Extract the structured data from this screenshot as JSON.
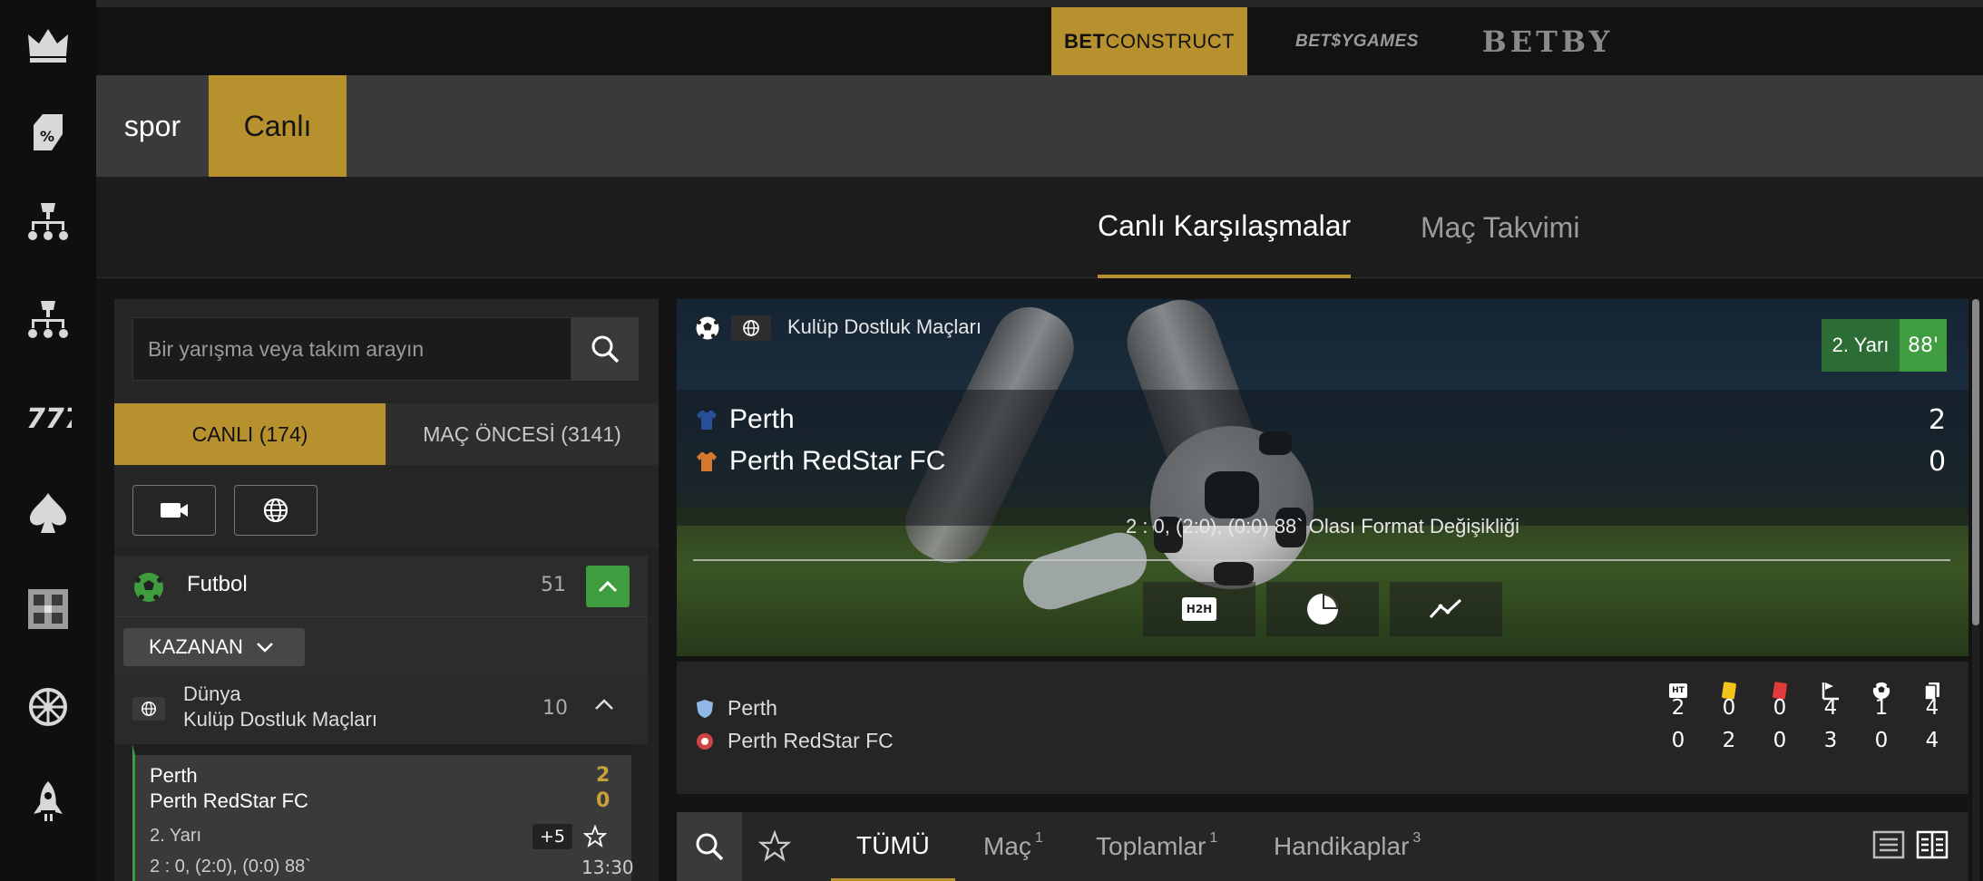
{
  "providers": {
    "betconstruct_bold": "BET",
    "betconstruct_rest": "CONSTRUCT",
    "betsygames": "BET$YGAMES",
    "betby": "BETBY"
  },
  "nav": {
    "items": [
      "spor",
      "Canlı"
    ],
    "active": "Canlı"
  },
  "tabs": {
    "live": "Canlı Karşılaşmalar",
    "calendar": "Maç Takvimi"
  },
  "search": {
    "placeholder": "Bir yarışma veya takım arayın"
  },
  "modes": {
    "live": "CANLI (174)",
    "prematch": "MAÇ ÖNCESİ (3141)"
  },
  "sport": {
    "name": "Futbol",
    "count": "51"
  },
  "market_select": {
    "label": "KAZANAN"
  },
  "competition": {
    "region": "Dünya",
    "name": "Kulüp Dostluk Maçları",
    "count": "10"
  },
  "match_card": {
    "team1": "Perth",
    "team2": "Perth RedStar FC",
    "score1": "2",
    "score2": "0",
    "period": "2. Yarı",
    "more": "+5",
    "info": "2 : 0, (2:0), (0:0) 88`",
    "time": "13:30"
  },
  "hero": {
    "competition": "Kulüp Dostluk Maçları",
    "period": "2. Yarı",
    "minute": "88'",
    "team1": "Perth",
    "team2": "Perth RedStar FC",
    "score1": "2",
    "score2": "0",
    "info": "2 : 0, (2:0), (0:0) 88` Olası Format Değişikliği",
    "h2h": "H2H"
  },
  "stats": {
    "columns": [
      "HT",
      "yellow-card",
      "red-card",
      "corner",
      "goal",
      "substitution"
    ],
    "rows": [
      {
        "team": "Perth",
        "values": [
          "2",
          "0",
          "0",
          "4",
          "1",
          "4"
        ]
      },
      {
        "team": "Perth RedStar FC",
        "values": [
          "0",
          "2",
          "0",
          "3",
          "0",
          "4"
        ]
      }
    ]
  },
  "market_tabs": [
    {
      "label": "TÜMÜ",
      "count": ""
    },
    {
      "label": "Maç",
      "count": "1"
    },
    {
      "label": "Toplamlar",
      "count": "1"
    },
    {
      "label": "Handikaplar",
      "count": "3"
    }
  ],
  "colors": {
    "accent": "#b8912f",
    "live_green": "#3f9d3f",
    "dark_green": "#2c6d36"
  }
}
